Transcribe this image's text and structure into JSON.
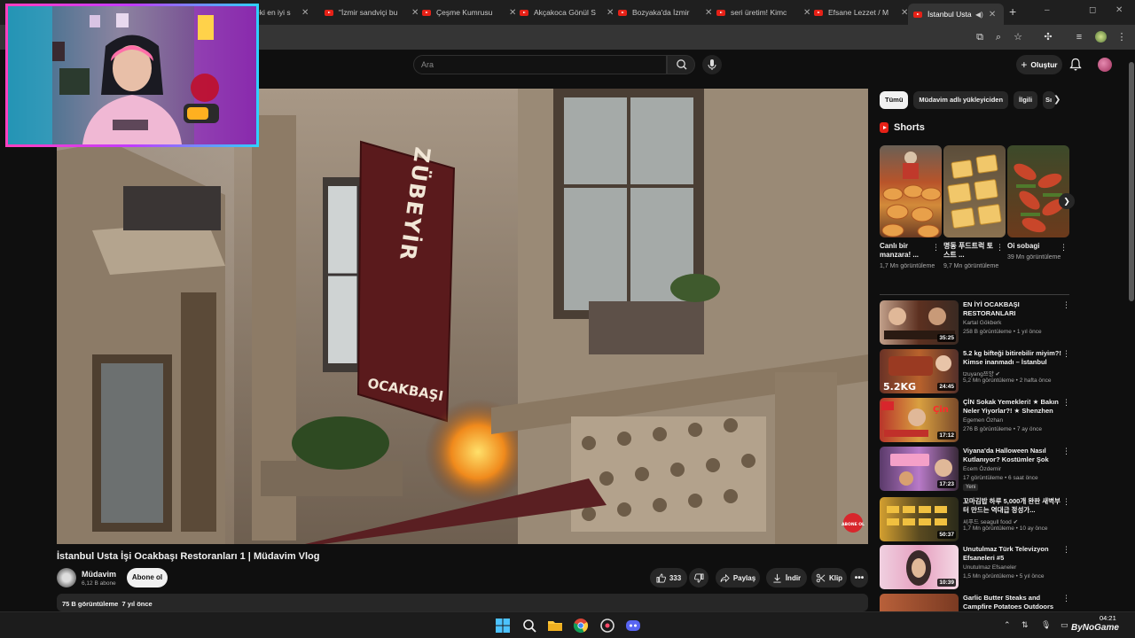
{
  "browser": {
    "tabs": [
      {
        "label": "eki en iyi s",
        "active": false
      },
      {
        "label": "\"İzmir sandviçi bu",
        "active": false
      },
      {
        "label": "Çeşme Kumrusu",
        "active": false
      },
      {
        "label": "Akçakoca Gönül S",
        "active": false
      },
      {
        "label": "Bozyaka'da İzmir",
        "active": false
      },
      {
        "label": "seri üretim! Kimc",
        "active": false
      },
      {
        "label": "Efsane Lezzet / M",
        "active": false
      },
      {
        "label": "İstanbul Usta",
        "active": true
      }
    ],
    "new_tab": "+",
    "window_controls": {
      "minimize": "–",
      "maximize": "◻",
      "close": "✕"
    }
  },
  "youtube": {
    "search_placeholder": "Ara",
    "create_label": "Oluştur"
  },
  "video": {
    "sign_text": "ZÜBEYİR",
    "sign_sub": "OCAKBAŞI",
    "subscribe_overlay": "ABONE OL",
    "title": "İstanbul Usta İşi Ocakbaşı Restoranları 1 | Müdavim Vlog",
    "channel": "Müdavim",
    "subscribers": "6,12 B abone",
    "subscribe_label": "Abone ol",
    "likes": "333",
    "share_label": "Paylaş",
    "download_label": "İndir",
    "clip_label": "Klip",
    "views": "75 B görüntüleme",
    "age": "7 yıl önce"
  },
  "sidebar": {
    "chips": [
      {
        "label": "Tümü",
        "active": true
      },
      {
        "label": "Müdavim adlı yükleyiciden",
        "active": false
      },
      {
        "label": "İlgili",
        "active": false
      },
      {
        "label": "Sı",
        "active": false
      }
    ],
    "shorts_title": "Shorts",
    "shorts": [
      {
        "title": "Canlı bir manzara! ...",
        "views": "1,7 Mn görüntüleme"
      },
      {
        "title": "명동 푸드트럭 토스트 ...",
        "views": "9,7 Mn görüntüleme"
      },
      {
        "title": "Oi sobagi",
        "views": "39 Mn görüntüleme"
      }
    ],
    "recommendations": [
      {
        "title": "EN İYİ OCAKBAŞI RESTORANLARI",
        "channel": "Kartal Gökberk",
        "meta": "258 B görüntüleme • 1 yıl önce",
        "duration": "35:25",
        "badge": ""
      },
      {
        "title": "5.2 kg bifteği bitirebilir miyim?! Kimse inanmadı – İstanbul Sal...",
        "channel": "tzuyang쯔양 ✔",
        "meta": "5,2 Mn görüntüleme • 2 hafta önce",
        "duration": "24:45",
        "badge": ""
      },
      {
        "title": "ÇİN Sokak Yemekleri! ★ Bakın Neler Yiyorlar?! ★ Shenzhen",
        "channel": "Egemen Özhan",
        "meta": "276 B görüntüleme • 7 ay önce",
        "duration": "17:12",
        "badge": ""
      },
      {
        "title": "Viyana'da Halloween Nasıl Kutlanıyor? Kostümler Şok Etti...",
        "channel": "Ecem Özdemir",
        "meta": "17 görüntüleme • 6 saat önce",
        "duration": "17:23",
        "badge": "Yeni"
      },
      {
        "title": "꼬마김밥 하루 5,000개 완판 새벽부터 만드는 역대급 정성가...",
        "channel": "씨푸드 seagull food ✔",
        "meta": "1,7 Mn görüntüleme • 10 ay önce",
        "duration": "50:37",
        "badge": ""
      },
      {
        "title": "Unutulmaz Türk Televizyon Efsaneleri #5",
        "channel": "Unutulmaz Efsaneler",
        "meta": "1,5 Mn görüntüleme • 5 yıl önce",
        "duration": "10:39",
        "badge": ""
      },
      {
        "title": "Garlic Butter Steaks and Campfire Potatoes Outdoors",
        "channel": "",
        "meta": "",
        "duration": "",
        "badge": ""
      }
    ]
  },
  "taskbar": {
    "time": "04:21",
    "watermark": "ByNoGame"
  },
  "icons": {
    "search": "search-icon",
    "mic": "mic-icon",
    "bell": "bell-icon",
    "like": "thumbs-up-icon",
    "dislike": "thumbs-down-icon",
    "share": "share-icon",
    "download": "download-icon",
    "clip": "scissors-icon",
    "more": "more-horizontal-icon"
  },
  "colors": {
    "youtube_red": "#e62117",
    "background": "#0f0f0f",
    "surface": "#272727",
    "webcam_border_start": "#ff3fbf",
    "webcam_border_end": "#2fd0ff"
  }
}
